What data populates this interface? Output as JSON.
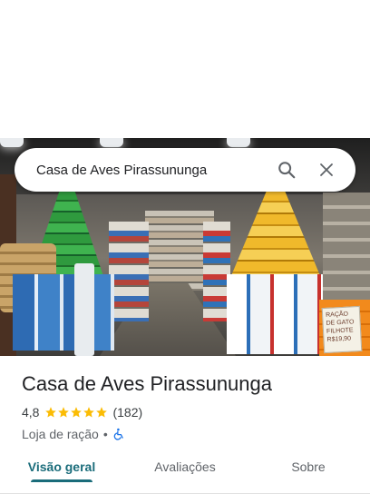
{
  "search": {
    "query": "Casa de Aves Pirassununga"
  },
  "photo": {
    "sign_text": "RAÇÃO DE GATO FILHOTE R$19,90"
  },
  "place": {
    "name": "Casa de Aves Pirassununga",
    "rating": "4,8",
    "review_count": "(182)",
    "category": "Loja de ração",
    "separator": "•",
    "accessibility_icon": "wheelchair-icon"
  },
  "tabs": [
    {
      "label": "Visão geral",
      "active": true
    },
    {
      "label": "Avaliações",
      "active": false
    },
    {
      "label": "Sobre",
      "active": false
    }
  ],
  "colors": {
    "accent": "#1a6c7a",
    "star": "#fbbc04",
    "accessibility": "#1a73e8"
  }
}
